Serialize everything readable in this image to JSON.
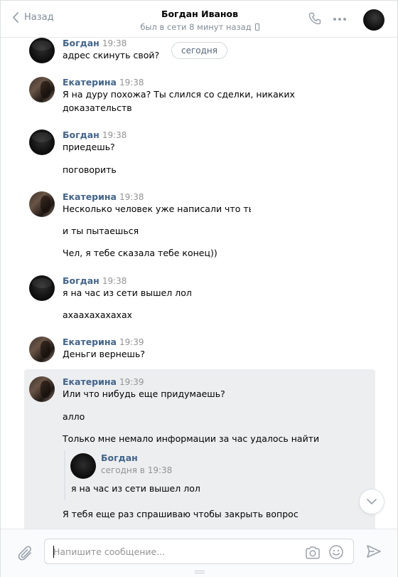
{
  "header": {
    "back_label": "Назад",
    "peer_name": "Богдан Иванов",
    "peer_status": "был в сети 8 минут назад"
  },
  "date_separator": "сегодня",
  "messages": [
    {
      "author": "Богдан",
      "time": "19:38",
      "lines": [
        "адрес скинуть свой?"
      ]
    },
    {
      "author": "Екатерина",
      "time": "19:38",
      "lines": [
        "Я на дуру похожа? Ты слился со сделки, никаких",
        "доказательств"
      ]
    },
    {
      "author": "Богдан",
      "time": "19:38",
      "lines": [
        "приедешь?",
        "поговорить"
      ]
    },
    {
      "author": "Екатерина",
      "time": "19:38",
      "lines": [
        "Несколько человек уже написали что ты на",
        "и ты пытаешься н",
        "Чел, я тебе сказала тебе конец))"
      ]
    },
    {
      "author": "Богдан",
      "time": "19:38",
      "lines": [
        "я на час из сети вышел лол",
        "ахаахахахахах"
      ]
    },
    {
      "author": "Екатерина",
      "time": "19:39",
      "lines": [
        "Деньги вернешь?"
      ]
    },
    {
      "author": "Екатерина",
      "time": "19:39",
      "lines": [
        "Или что нибудь еще придумаешь?",
        "алло",
        "Только мне немало информации за час удалось найти",
        "Я тебя еще раз спрашиваю чтобы закрыть вопрос"
      ]
    }
  ],
  "forwarded": {
    "author": "Богдан",
    "time": "сегодня в 19:38",
    "text": "я на час из сети вышел лол"
  },
  "composer": {
    "placeholder": "Напишите сообщение..."
  },
  "colors": {
    "author_link": "#42648b",
    "selected_background": "#edeef0"
  }
}
